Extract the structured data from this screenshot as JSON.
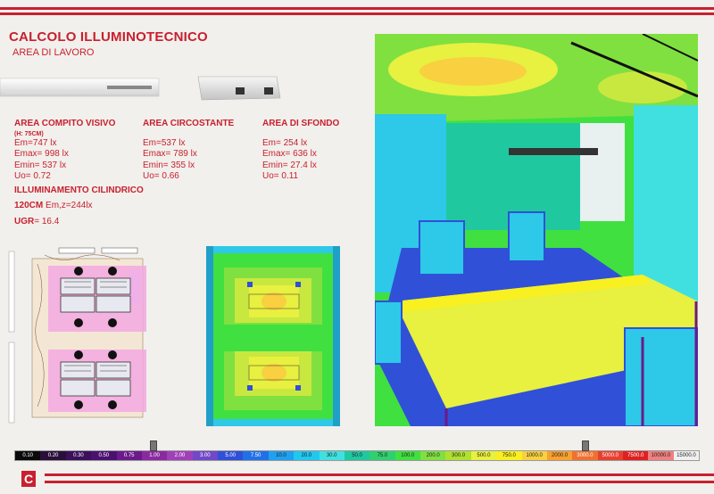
{
  "header": {
    "title": "CALCOLO ILLUMINOTECNICO",
    "subtitle": "AREA DI LAVORO"
  },
  "areas": [
    {
      "heading": "AREA COMPITO VISIVO",
      "subheading": "(H: 75CM)",
      "lines": [
        "Em=747 lx",
        "Emax= 998 lx",
        "Emin= 537 lx",
        "Uo= 0.72"
      ]
    },
    {
      "heading": "AREA CIRCOSTANTE",
      "lines": [
        "Em=537 lx",
        "Emax= 789 lx",
        "Emin= 355 lx",
        "Uo= 0.66"
      ]
    },
    {
      "heading": "AREA DI SFONDO",
      "lines": [
        "Em= 254 lx",
        "Emax= 636 lx",
        "Emin= 27.4 lx",
        "Uo= 0.11"
      ]
    }
  ],
  "cylindrical": {
    "heading": "ILLUMINAMENTO CILINDRICO",
    "height_label": "120CM",
    "value": "Em,z=244lx"
  },
  "ugr": {
    "label": "UGR",
    "value": "= 16.4"
  },
  "scale": {
    "values": [
      "0.10",
      "0.20",
      "0.30",
      "0.50",
      "0.75",
      "1.00",
      "2.00",
      "3.00",
      "5.00",
      "7.50",
      "10.0",
      "20.0",
      "30.0",
      "50.0",
      "75.0",
      "100.0",
      "200.0",
      "300.0",
      "500.0",
      "750.0",
      "1000.0",
      "2000.0",
      "3000.0",
      "5000.0",
      "7500.0",
      "10000.0",
      "15000.0"
    ],
    "colors": [
      "#0a0a0a",
      "#2a0f3a",
      "#3b0f5a",
      "#4c1070",
      "#6a1a8a",
      "#8a2aa0",
      "#a040b8",
      "#7048c8",
      "#3050d8",
      "#2070e8",
      "#20a0f0",
      "#20c8f0",
      "#40e0e0",
      "#20c8a0",
      "#30d070",
      "#40e040",
      "#80e040",
      "#b0e030",
      "#e8f040",
      "#f8f020",
      "#f8d040",
      "#f8a030",
      "#f07030",
      "#e84030",
      "#e02020",
      "#f08080",
      "#f0f0f0"
    ],
    "marker_indices": [
      5,
      22
    ]
  },
  "footer": {
    "logo_letter": "C"
  }
}
